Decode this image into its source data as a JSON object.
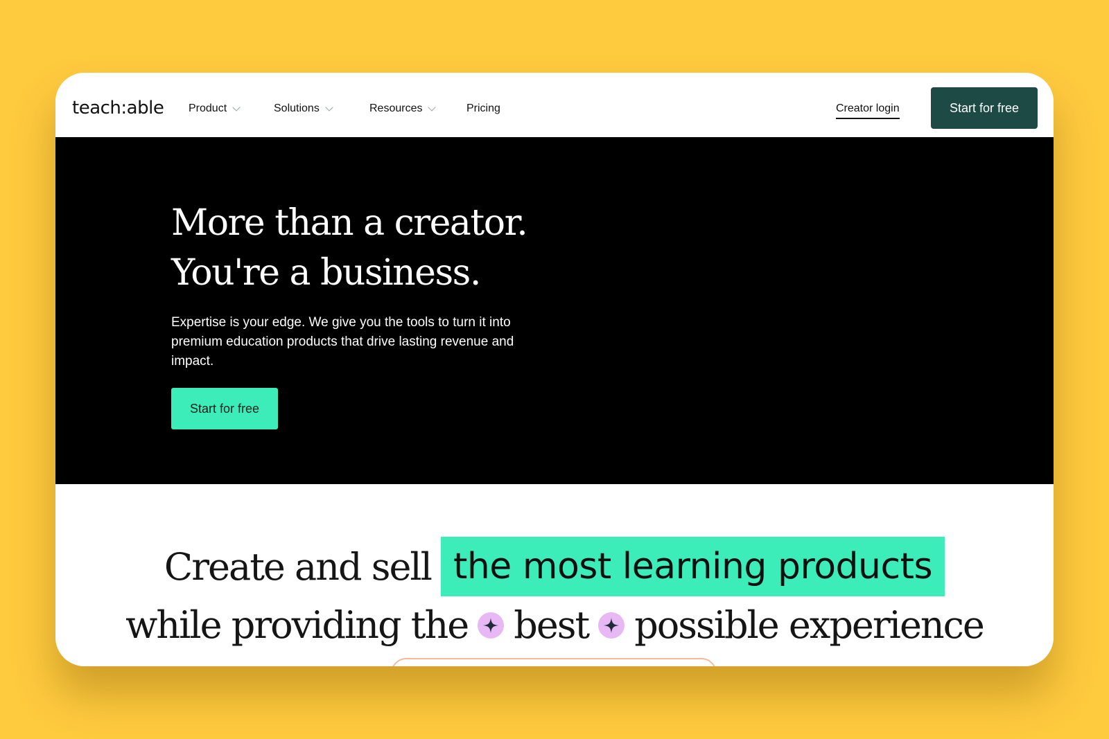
{
  "nav": {
    "logo": "teach:able",
    "items": [
      {
        "label": "Product"
      },
      {
        "label": "Solutions"
      },
      {
        "label": "Resources"
      },
      {
        "label": "Pricing"
      }
    ],
    "login": "Creator login",
    "cta": "Start for free"
  },
  "hero": {
    "title_line1": "More than a creator.",
    "title_line2": "You're a business.",
    "description": "Expertise is your edge. We give you the tools to turn it into premium education products that drive lasting revenue and impact.",
    "cta": "Start for free"
  },
  "tagline": {
    "part1": "Create and sell",
    "highlight": "the most learning products",
    "part2": "while providing the",
    "part3": "best",
    "part4": "possible experience"
  },
  "colors": {
    "page_bg": "#FECA3E",
    "brand_dark_green": "#1E4A45",
    "accent_mint": "#3DEDB9",
    "sparkle_bg": "#E8B8F4"
  },
  "icons": [
    "chevron-down-icon",
    "sparkle-icon"
  ]
}
